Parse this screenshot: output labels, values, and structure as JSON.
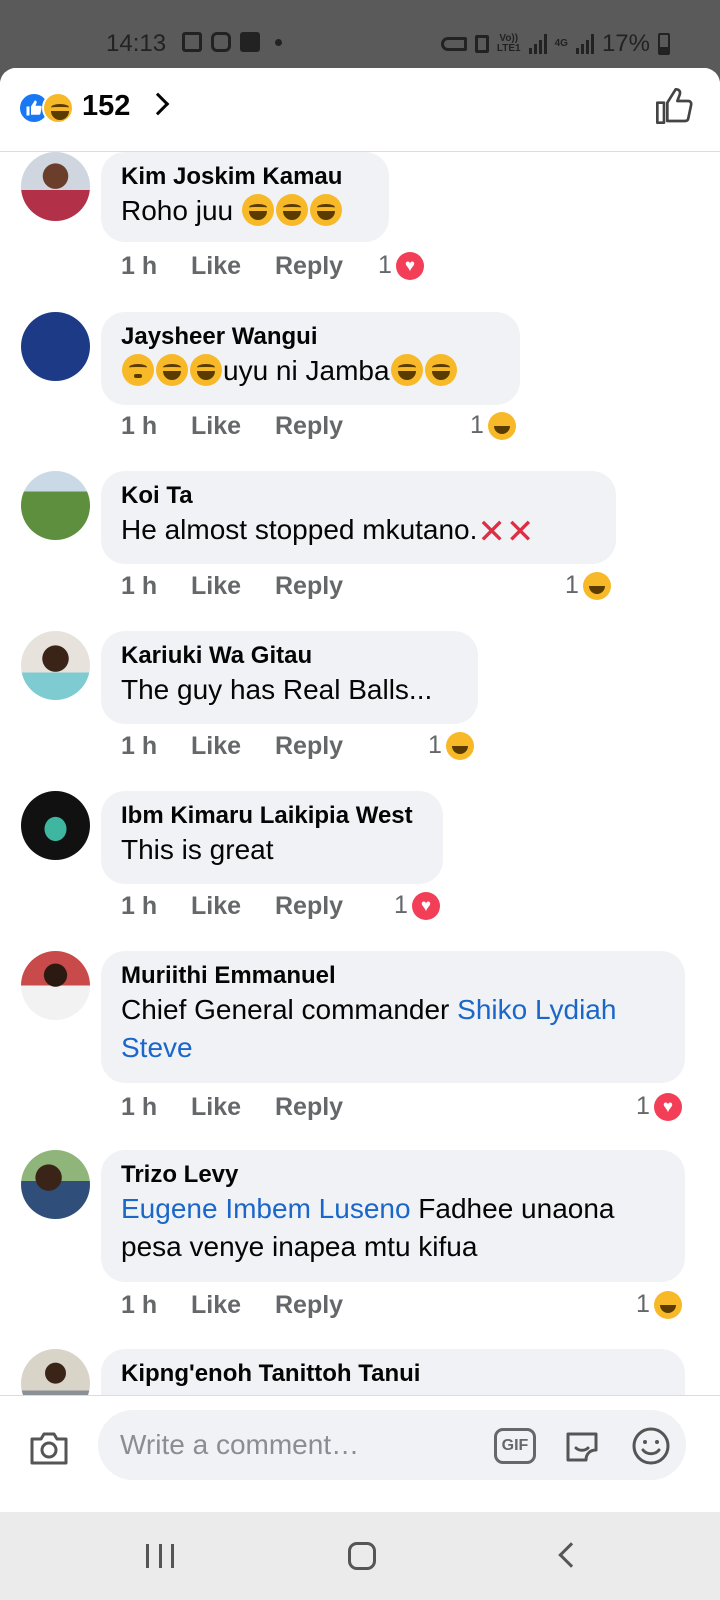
{
  "status_bar": {
    "time": "14:13",
    "network_badge_top": "Vo))",
    "network_badge_bottom": "LTE1",
    "network_type": "4G",
    "battery": "17%"
  },
  "header": {
    "reaction_icons": [
      "like-icon",
      "haha-icon"
    ],
    "reaction_count": "152"
  },
  "comments": [
    {
      "author": "Kim Joskim Kamau",
      "text": "Roho juu",
      "emoji_after": [
        "sweat-smile-icon",
        "sweat-smile-icon",
        "sweat-smile-icon"
      ],
      "time": "1 h",
      "like_label": "Like",
      "reply_label": "Reply",
      "reaction_count": "1",
      "reaction": "love"
    },
    {
      "author": "Jaysheer Wangui",
      "emoji_before": [
        "flushed-icon",
        "joy-icon",
        "joy-icon"
      ],
      "text": "uyu ni Jamba",
      "emoji_after": [
        "joy-icon",
        "joy-icon"
      ],
      "time": "1 h",
      "like_label": "Like",
      "reply_label": "Reply",
      "reaction_count": "1",
      "reaction": "haha"
    },
    {
      "author": "Koi Ta",
      "text": "He almost stopped mkutano.",
      "emoji_after": [
        "cross-mark-icon",
        "cross-mark-icon"
      ],
      "time": "1 h",
      "like_label": "Like",
      "reply_label": "Reply",
      "reaction_count": "1",
      "reaction": "haha"
    },
    {
      "author": "Kariuki Wa Gitau",
      "text": "The guy has Real Balls...",
      "time": "1 h",
      "like_label": "Like",
      "reply_label": "Reply",
      "reaction_count": "1",
      "reaction": "haha"
    },
    {
      "author": "Ibm Kimaru Laikipia West",
      "text": "This is great",
      "time": "1 h",
      "like_label": "Like",
      "reply_label": "Reply",
      "reaction_count": "1",
      "reaction": "love"
    },
    {
      "author": "Muriithi Emmanuel",
      "text": "Chief General commander ",
      "mention": "Shiko Lydiah Steve",
      "time": "1 h",
      "like_label": "Like",
      "reply_label": "Reply",
      "reaction_count": "1",
      "reaction": "love"
    },
    {
      "author": "Trizo Levy",
      "mention": "Eugene Imbem Luseno",
      "text": " Fadhee unaona pesa venye inapea mtu kifua",
      "time": "1 h",
      "like_label": "Like",
      "reply_label": "Reply",
      "reaction_count": "1",
      "reaction": "haha"
    },
    {
      "author": "Kipng'enoh Tanittoh Tanui"
    }
  ],
  "composer": {
    "placeholder": "Write a comment…",
    "gif_label": "GIF"
  },
  "colors": {
    "mention": "#1b66c9",
    "like_blue": "#1877f2",
    "love_red": "#f33e58",
    "haha_yellow": "#f7b928",
    "bubble_bg": "#f0f2f5"
  }
}
